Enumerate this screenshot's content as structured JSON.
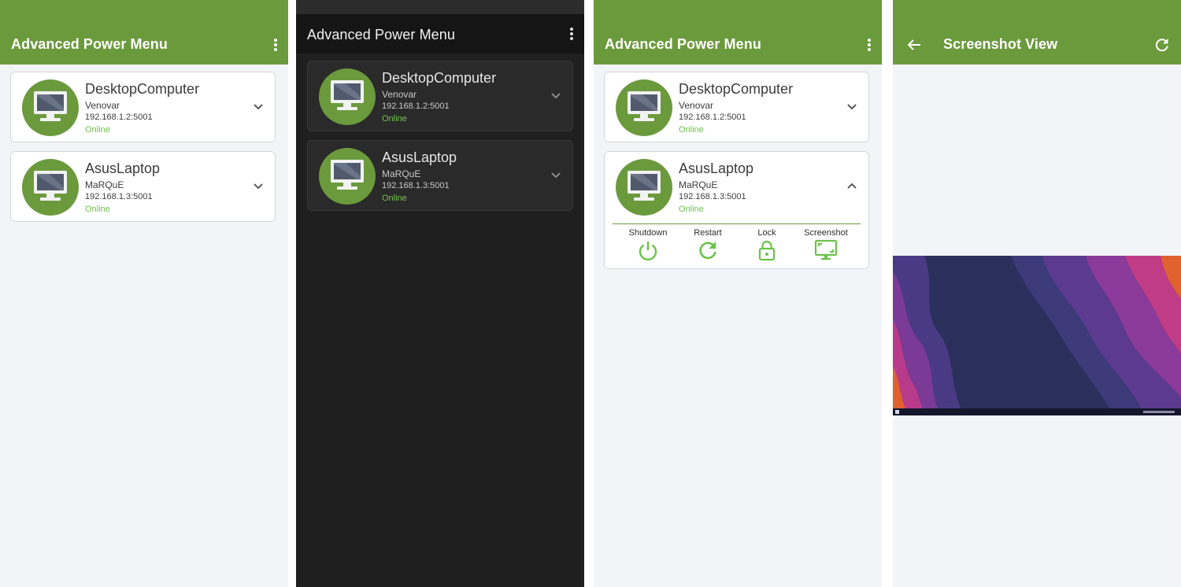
{
  "panels": [
    {
      "theme": "light",
      "title": "Advanced Power Menu",
      "devices": [
        {
          "name": "DesktopComputer",
          "user": "Venovar",
          "address": "192.168.1.2:5001",
          "status": "Online"
        },
        {
          "name": "AsusLaptop",
          "user": "MaRQuE",
          "address": "192.168.1.3:5001",
          "status": "Online"
        }
      ]
    },
    {
      "theme": "dark",
      "title": "Advanced Power Menu",
      "devices": [
        {
          "name": "DesktopComputer",
          "user": "Venovar",
          "address": "192.168.1.2:5001",
          "status": "Online"
        },
        {
          "name": "AsusLaptop",
          "user": "MaRQuE",
          "address": "192.168.1.3:5001",
          "status": "Online"
        }
      ]
    },
    {
      "theme": "light",
      "title": "Advanced Power Menu",
      "devices": [
        {
          "name": "DesktopComputer",
          "user": "Venovar",
          "address": "192.168.1.2:5001",
          "status": "Online",
          "expanded": false
        },
        {
          "name": "AsusLaptop",
          "user": "MaRQuE",
          "address": "192.168.1.3:5001",
          "status": "Online",
          "expanded": true
        }
      ],
      "actions": [
        {
          "label": "Shutdown",
          "icon": "power-icon"
        },
        {
          "label": "Restart",
          "icon": "restart-icon"
        },
        {
          "label": "Lock",
          "icon": "lock-icon"
        },
        {
          "label": "Screenshot",
          "icon": "screenshot-icon"
        }
      ]
    },
    {
      "theme": "light",
      "title": "Screenshot View",
      "icons": {
        "back": "arrow-back-icon",
        "refresh": "refresh-icon"
      },
      "image": "desktop-wallpaper-screenshot"
    }
  ],
  "colors": {
    "primary": "#6b9a3d",
    "online": "#6cc24a",
    "light_background": "#f3f4f8",
    "dark_background": "#1f1f1f",
    "dark_card": "#2a2a2a"
  }
}
